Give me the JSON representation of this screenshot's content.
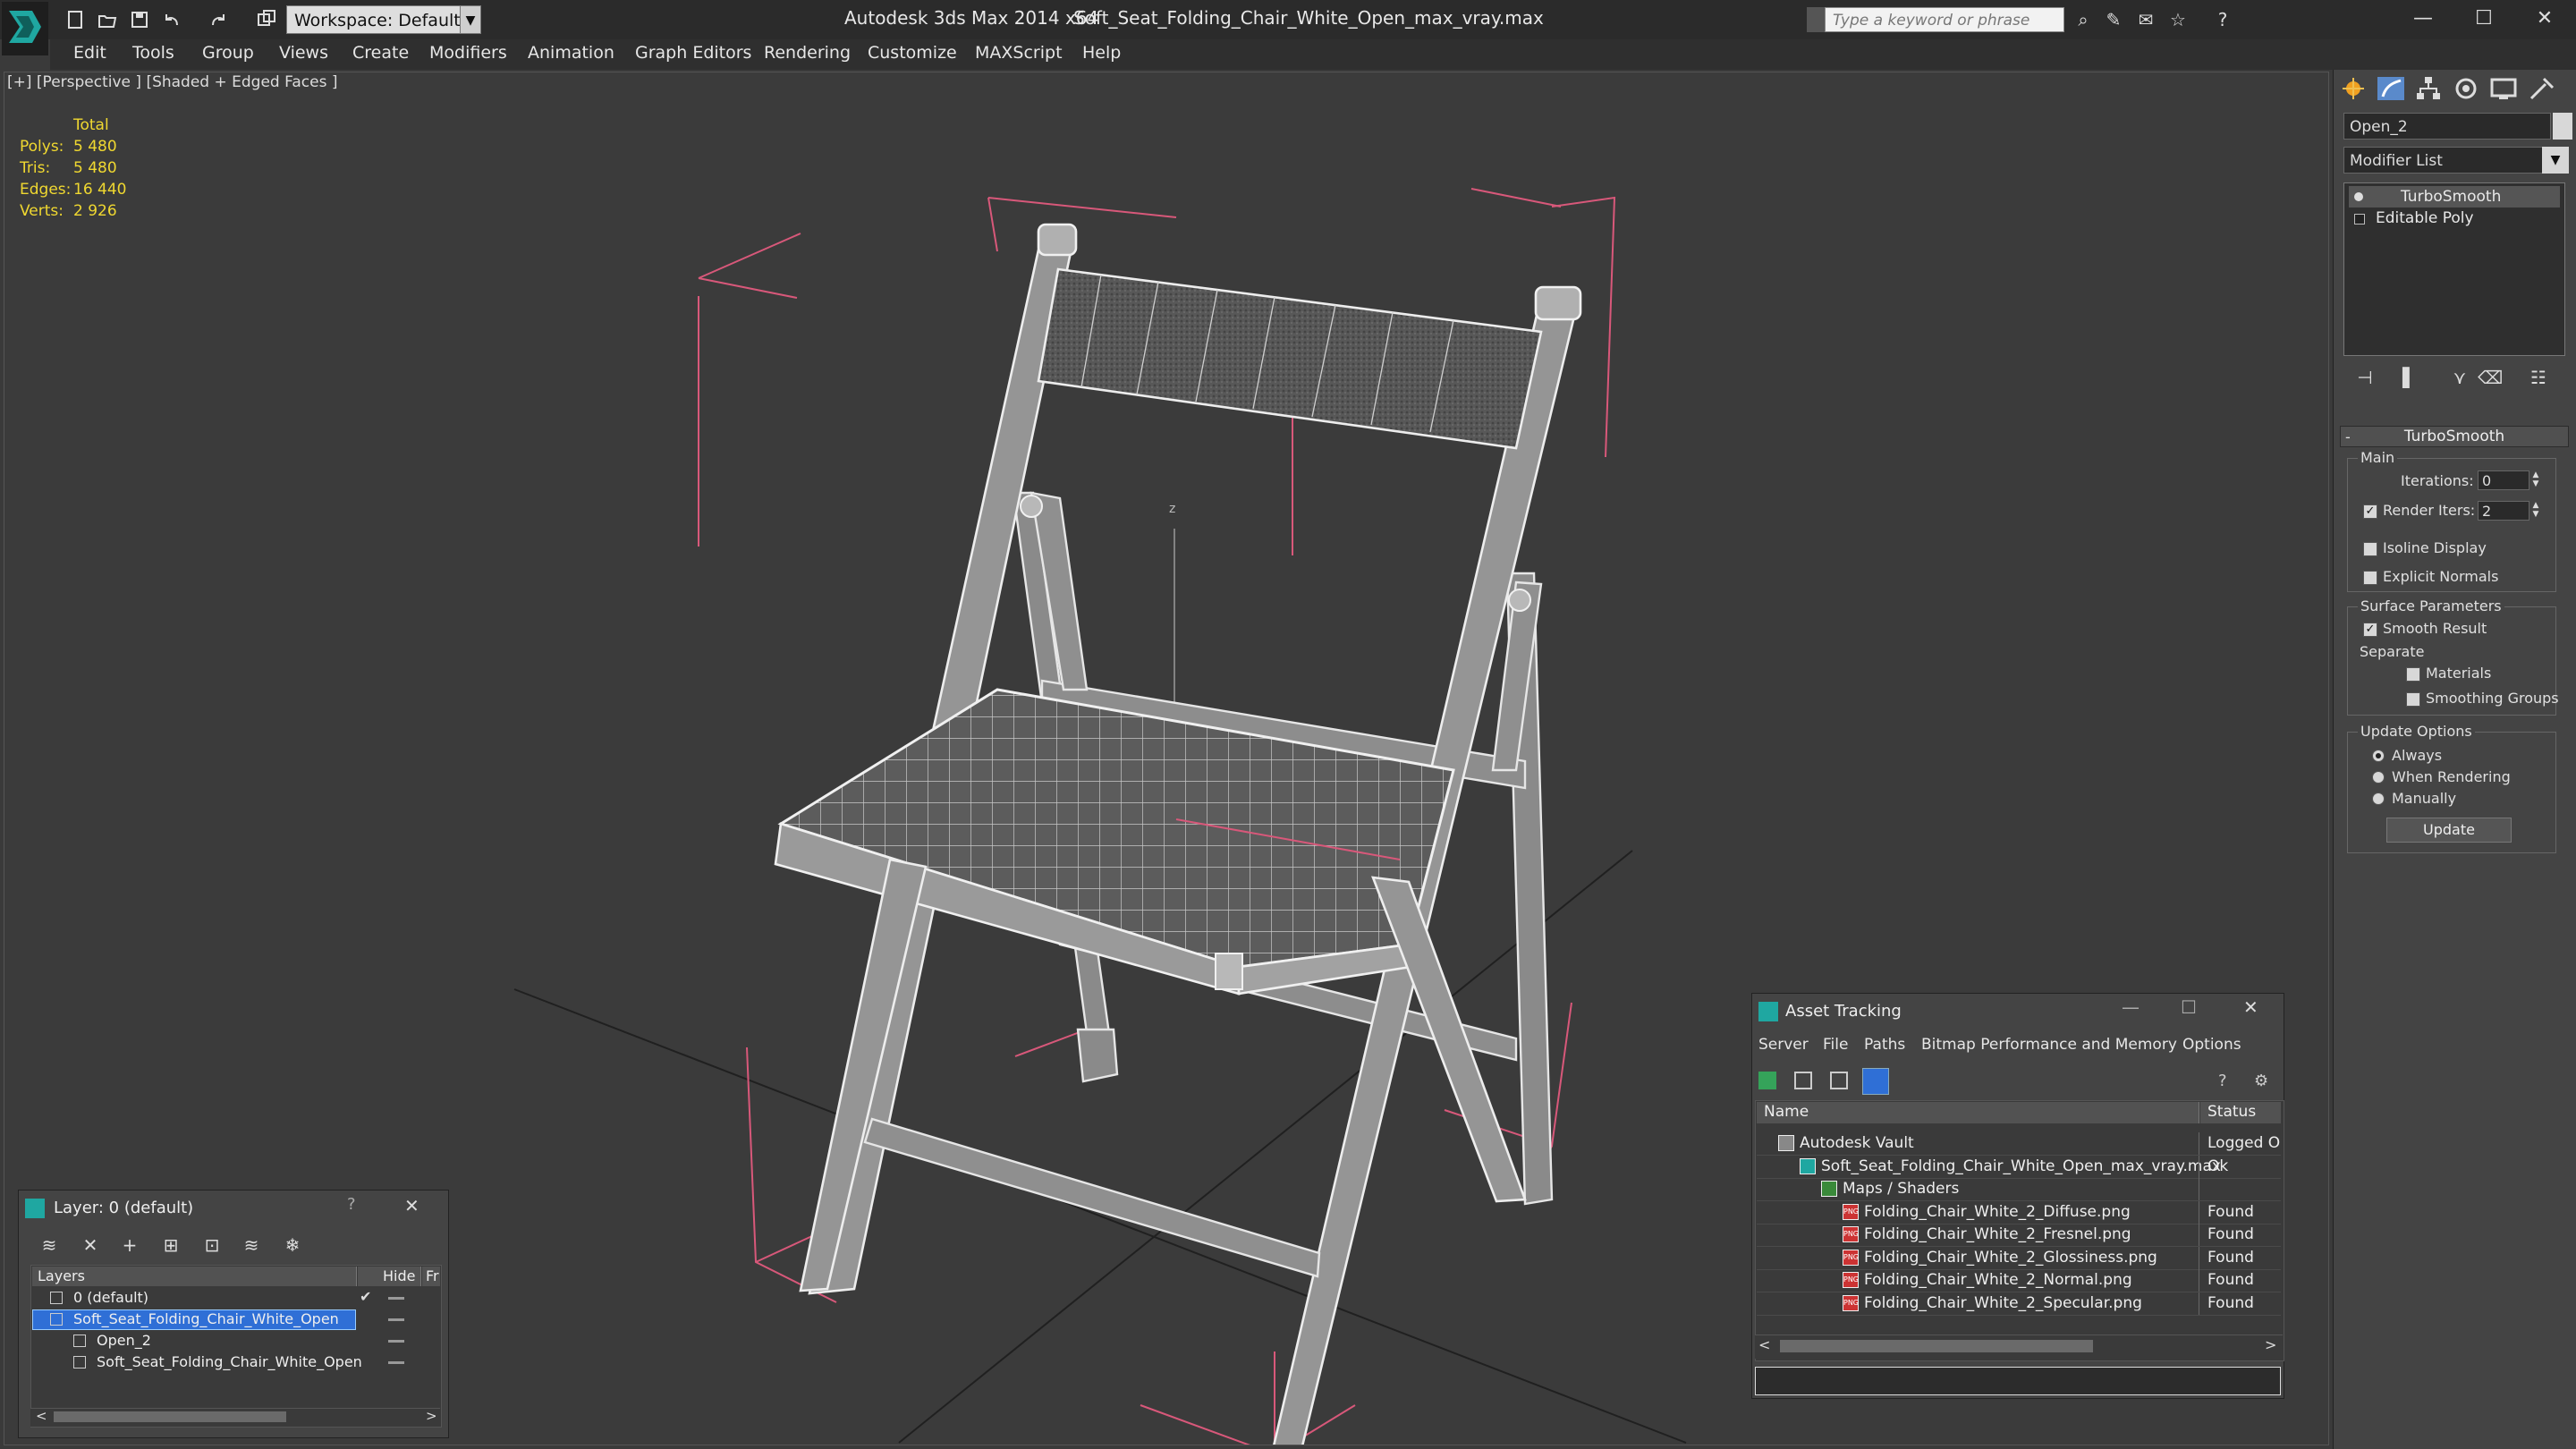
{
  "titlebar": {
    "workspace": "Workspace: Default",
    "app_title": "Autodesk 3ds Max  2014 x64",
    "file_title": "Soft_Seat_Folding_Chair_White_Open_max_vray.max",
    "search_placeholder": "Type a keyword or phrase",
    "minimize": "—",
    "maximize": "☐",
    "close": "✕"
  },
  "menu": [
    "Edit",
    "Tools",
    "Group",
    "Views",
    "Create",
    "Modifiers",
    "Animation",
    "Graph Editors",
    "Rendering",
    "Customize",
    "MAXScript",
    "Help"
  ],
  "viewport": {
    "label": "[+] [Perspective ] [Shaded + Edged Faces ]",
    "stats_header": "Total",
    "stats": [
      {
        "label": "Polys:",
        "value": "5 480"
      },
      {
        "label": "Tris:",
        "value": "5 480"
      },
      {
        "label": "Edges:",
        "value": "16 440"
      },
      {
        "label": "Verts:",
        "value": "2 926"
      }
    ],
    "axis_label": "z"
  },
  "command_panel": {
    "object_name": "Open_2",
    "modifier_list": "Modifier List",
    "stack": [
      "TurboSmooth",
      "Editable Poly"
    ],
    "rollout_title": "TurboSmooth",
    "main_label": "Main",
    "iterations_label": "Iterations:",
    "iterations_value": "0",
    "render_iters_label": "Render Iters:",
    "render_iters_value": "2",
    "isoline_label": "Isoline Display",
    "explicit_normals_label": "Explicit Normals",
    "surface_params_label": "Surface Parameters",
    "smooth_result_label": "Smooth Result",
    "separate_label": "Separate",
    "materials_label": "Materials",
    "smoothing_groups_label": "Smoothing Groups",
    "update_options_label": "Update Options",
    "always_label": "Always",
    "when_rendering_label": "When Rendering",
    "manually_label": "Manually",
    "update_button": "Update"
  },
  "asset_tracking": {
    "title": "Asset Tracking",
    "menu": [
      "Server",
      "File",
      "Paths",
      "Bitmap Performance and Memory",
      "Options"
    ],
    "col_name": "Name",
    "col_status": "Status",
    "rows": [
      {
        "name": "Autodesk Vault",
        "status": "Logged O",
        "indent": 1,
        "icon": "vault"
      },
      {
        "name": "Soft_Seat_Folding_Chair_White_Open_max_vray.max",
        "status": "Ok",
        "indent": 2,
        "icon": "max"
      },
      {
        "name": "Maps / Shaders",
        "status": "",
        "indent": 3,
        "icon": "maps"
      },
      {
        "name": "Folding_Chair_White_2_Diffuse.png",
        "status": "Found",
        "indent": 4,
        "icon": "png"
      },
      {
        "name": "Folding_Chair_White_2_Fresnel.png",
        "status": "Found",
        "indent": 4,
        "icon": "png"
      },
      {
        "name": "Folding_Chair_White_2_Glossiness.png",
        "status": "Found",
        "indent": 4,
        "icon": "png"
      },
      {
        "name": "Folding_Chair_White_2_Normal.png",
        "status": "Found",
        "indent": 4,
        "icon": "png"
      },
      {
        "name": "Folding_Chair_White_2_Specular.png",
        "status": "Found",
        "indent": 4,
        "icon": "png"
      }
    ]
  },
  "layer_dialog": {
    "title": "Layer: 0 (default)",
    "help": "?",
    "col_layers": "Layers",
    "col_hide": "Hide",
    "col_fr": "Fr",
    "rows": [
      {
        "name": "0 (default)",
        "indent": 1,
        "selected": false
      },
      {
        "name": "Soft_Seat_Folding_Chair_White_Open",
        "indent": 1,
        "selected": true
      },
      {
        "name": "Open_2",
        "indent": 2,
        "selected": false
      },
      {
        "name": "Soft_Seat_Folding_Chair_White_Open",
        "indent": 2,
        "selected": false
      }
    ]
  },
  "colors": {
    "stats_yellow": "#f0d830",
    "selection_blue": "#2f6fd6",
    "bbox_pink": "#d8587a"
  }
}
